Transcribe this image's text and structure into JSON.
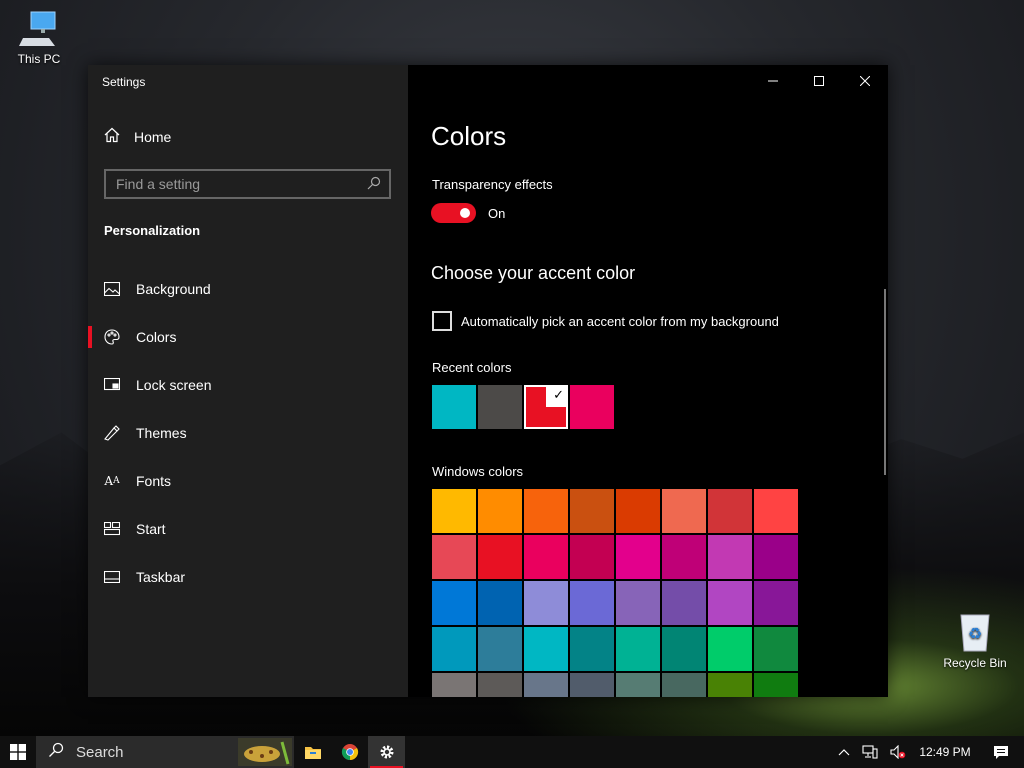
{
  "desktop": {
    "this_pc_label": "This PC",
    "recycle_bin_label": "Recycle Bin"
  },
  "window": {
    "app_title": "Settings",
    "controls": {
      "minimize": "—",
      "maximize": "☐",
      "close": "✕"
    }
  },
  "sidebar": {
    "home_label": "Home",
    "search_placeholder": "Find a setting",
    "section_label": "Personalization",
    "items": [
      {
        "label": "Background",
        "icon": "image-icon",
        "active": false
      },
      {
        "label": "Colors",
        "icon": "palette-icon",
        "active": true
      },
      {
        "label": "Lock screen",
        "icon": "lock-screen-icon",
        "active": false
      },
      {
        "label": "Themes",
        "icon": "themes-icon",
        "active": false
      },
      {
        "label": "Fonts",
        "icon": "fonts-icon",
        "active": false
      },
      {
        "label": "Start",
        "icon": "start-icon",
        "active": false
      },
      {
        "label": "Taskbar",
        "icon": "taskbar-icon",
        "active": false
      }
    ]
  },
  "content": {
    "title": "Colors",
    "transparency_label": "Transparency effects",
    "transparency_state": "On",
    "accent_heading": "Choose your accent color",
    "auto_pick_label": "Automatically pick an accent color from my background",
    "auto_pick_checked": false,
    "recent_label": "Recent colors",
    "recent_colors": [
      "#00b7c3",
      "#4c4a48",
      "#e81123",
      "#ea005e"
    ],
    "recent_selected_index": 2,
    "windows_label": "Windows colors",
    "windows_colors": [
      "#ffb900",
      "#ff8c00",
      "#f7630c",
      "#ca5010",
      "#da3b01",
      "#ef6950",
      "#d13438",
      "#ff4343",
      "#e74856",
      "#e81123",
      "#ea005e",
      "#c30052",
      "#e3008c",
      "#bf0077",
      "#c239b3",
      "#9a0089",
      "#0078d7",
      "#0063b1",
      "#8e8cd8",
      "#6b69d6",
      "#8764b8",
      "#744da9",
      "#b146c2",
      "#881798",
      "#0099bc",
      "#2d7d9a",
      "#00b7c3",
      "#038387",
      "#00b294",
      "#018574",
      "#00cc6a",
      "#10893e",
      "#7a7574",
      "#5d5a58",
      "#68768a",
      "#515c6b",
      "#567c73",
      "#486860",
      "#498205",
      "#107c10"
    ]
  },
  "taskbar": {
    "search_label": "Search",
    "apps": [
      {
        "name": "file-explorer",
        "icon": "folder-icon"
      },
      {
        "name": "chrome",
        "icon": "chrome-icon"
      },
      {
        "name": "settings",
        "icon": "gear-icon"
      }
    ],
    "time": "12:49 PM"
  },
  "colors": {
    "accent": "#e81123"
  }
}
